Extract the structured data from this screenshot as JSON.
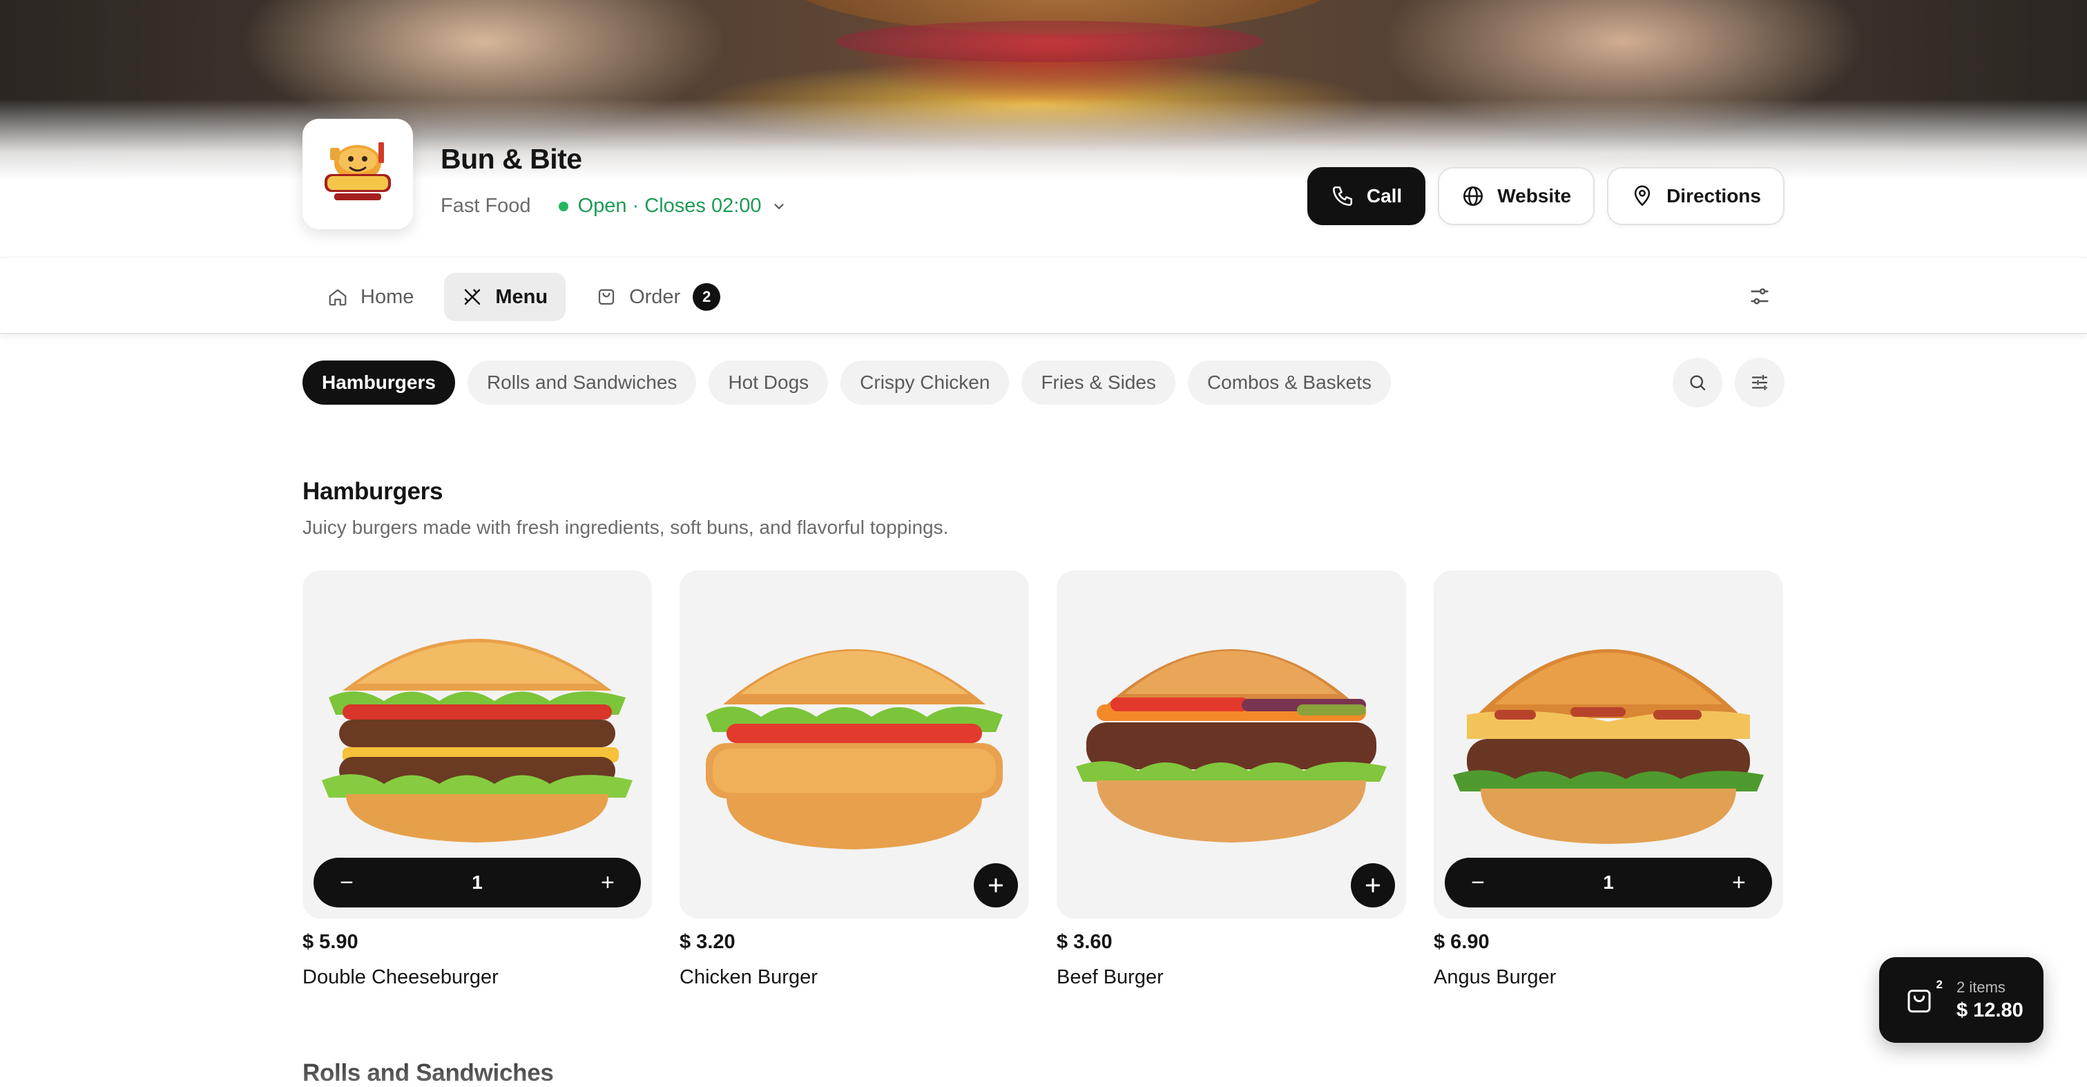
{
  "store": {
    "name": "Bun & Bite",
    "category": "Fast Food",
    "status": "Open · Closes 02:00"
  },
  "actions": {
    "call": "Call",
    "website": "Website",
    "directions": "Directions"
  },
  "nav": {
    "home": "Home",
    "menu": "Menu",
    "order": "Order",
    "order_count": "2"
  },
  "categories": [
    "Hamburgers",
    "Rolls and Sandwiches",
    "Hot Dogs",
    "Crispy Chicken",
    "Fries & Sides",
    "Combos & Baskets"
  ],
  "section": {
    "title": "Hamburgers",
    "description": "Juicy burgers made with fresh ingredients, soft buns, and flavorful toppings."
  },
  "items": [
    {
      "price": "$ 5.90",
      "name": "Double Cheeseburger",
      "quantity": "1"
    },
    {
      "price": "$ 3.20",
      "name": "Chicken Burger"
    },
    {
      "price": "$ 3.60",
      "name": "Beef Burger"
    },
    {
      "price": "$ 6.90",
      "name": "Angus Burger",
      "quantity": "1"
    }
  ],
  "next_section": {
    "title": "Rolls and Sandwiches"
  },
  "cart": {
    "badge": "2",
    "count": "2 items",
    "total": "$ 12.80"
  },
  "colors": {
    "accent": "#111111",
    "open_green": "#1f9a57",
    "chip_bg": "#f2f2f2"
  }
}
